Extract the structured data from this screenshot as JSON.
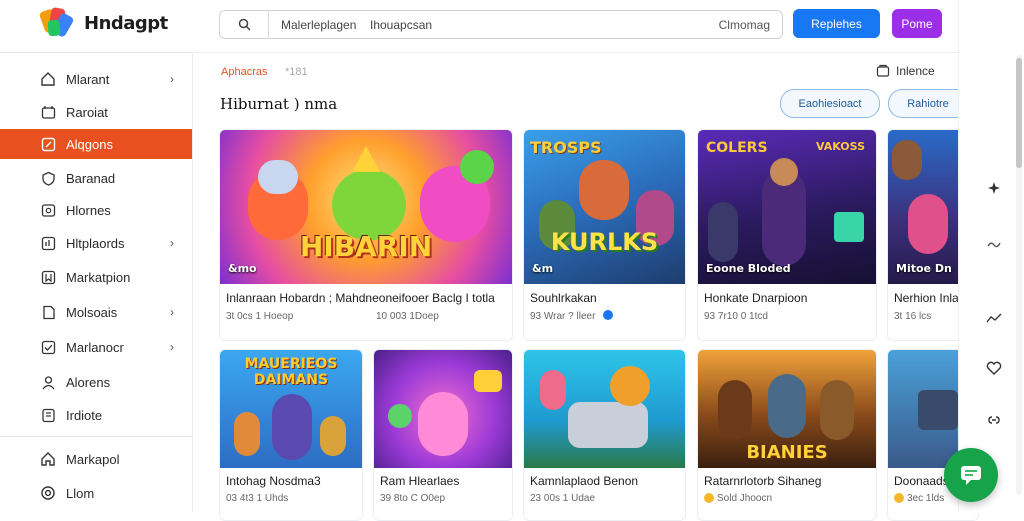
{
  "app": {
    "name": "Hndagpt"
  },
  "sidebar": {
    "items": [
      {
        "label": "Mlarant",
        "icon": "home-icon",
        "chevron": "›",
        "active": false
      },
      {
        "label": "Raroiat",
        "icon": "calendar-icon",
        "chevron": "",
        "active": false
      },
      {
        "label": "Alqgons",
        "icon": "edit-icon",
        "chevron": "",
        "active": true
      },
      {
        "label": "Baranad",
        "icon": "shield-icon",
        "chevron": "",
        "active": false
      },
      {
        "label": "Hlornes",
        "icon": "image-icon",
        "chevron": "",
        "active": false
      },
      {
        "label": "Hltplaords",
        "icon": "chart-icon",
        "chevron": "›",
        "active": false
      },
      {
        "label": "Markatpion",
        "icon": "bookmark-icon",
        "chevron": "",
        "active": false
      },
      {
        "label": "Molsoais",
        "icon": "document-icon",
        "chevron": "›",
        "active": false
      },
      {
        "label": "Marlanocr",
        "icon": "checklist-icon",
        "chevron": "›",
        "active": false
      },
      {
        "label": "Alorens",
        "icon": "person-icon",
        "chevron": "",
        "active": false
      },
      {
        "label": "Irdiote",
        "icon": "note-icon",
        "chevron": "",
        "active": false
      }
    ],
    "footer": [
      {
        "label": "Markapol",
        "icon": "house-icon"
      },
      {
        "label": "Llom",
        "icon": "settings-icon"
      }
    ]
  },
  "topbar": {
    "search_text_1": "Malerleplagen",
    "search_text_2": "Ihouapcsan",
    "search_right": "Clmomag",
    "btn_primary": "Replehes",
    "btn_secondary": "Pome",
    "more": "•••"
  },
  "main": {
    "crumb": "Aphacras",
    "crumb_count": "*181",
    "invite_label": "Inlence",
    "section_title": "Hiburnat ) nma",
    "pill_1": "Eaohiesioact",
    "pill_2": "Rahiotre",
    "cards_row1": [
      {
        "title": "Inlanraan Hobardn ;   Mahdneoneifooer Baclg I totla",
        "meta": "3t 0cs  1 Hoeop",
        "meta2": "10 003 1Doep",
        "tag": "&mo"
      },
      {
        "title": "Souhlrkakan",
        "meta": "93 Wrar ? lleer",
        "tag": "&m"
      },
      {
        "title": "Honkate Dnarpioon",
        "meta": "93 7r10 0 1tcd",
        "tag": "Eoone Bloded"
      },
      {
        "title": "Nerhion Inla",
        "meta": "3t 16 lcs",
        "tag": "Mitoe Dn"
      }
    ],
    "cards_row2": [
      {
        "title": "Intohag Nosdma3",
        "meta": "03 4t3 1 Uhds"
      },
      {
        "title": "Ram Hlearlaes",
        "meta": "39 8to C  O0ep"
      },
      {
        "title": "Kamnlaplaod Benon",
        "meta": "23 00s  1 Udae"
      },
      {
        "title": "Ratarnrlotorb Sihaneg",
        "meta": "Sold Jhoocn"
      },
      {
        "title": "Doonaads",
        "meta": "3ec  1lds"
      }
    ],
    "thumb_texts": {
      "card1": "HIBARIN",
      "card2": "KURLKS",
      "card2_top": "TROSPS",
      "card3": "VAKOSS",
      "card3_top": "COLERS",
      "card4": "MAUERIEOS",
      "card4b": "DAIMANS",
      "card6": "BIANIES"
    }
  },
  "colors": {
    "accent": "#e8501f",
    "primary": "#1877f2",
    "secondary": "#9b2fe8",
    "fab": "#16a34a"
  }
}
